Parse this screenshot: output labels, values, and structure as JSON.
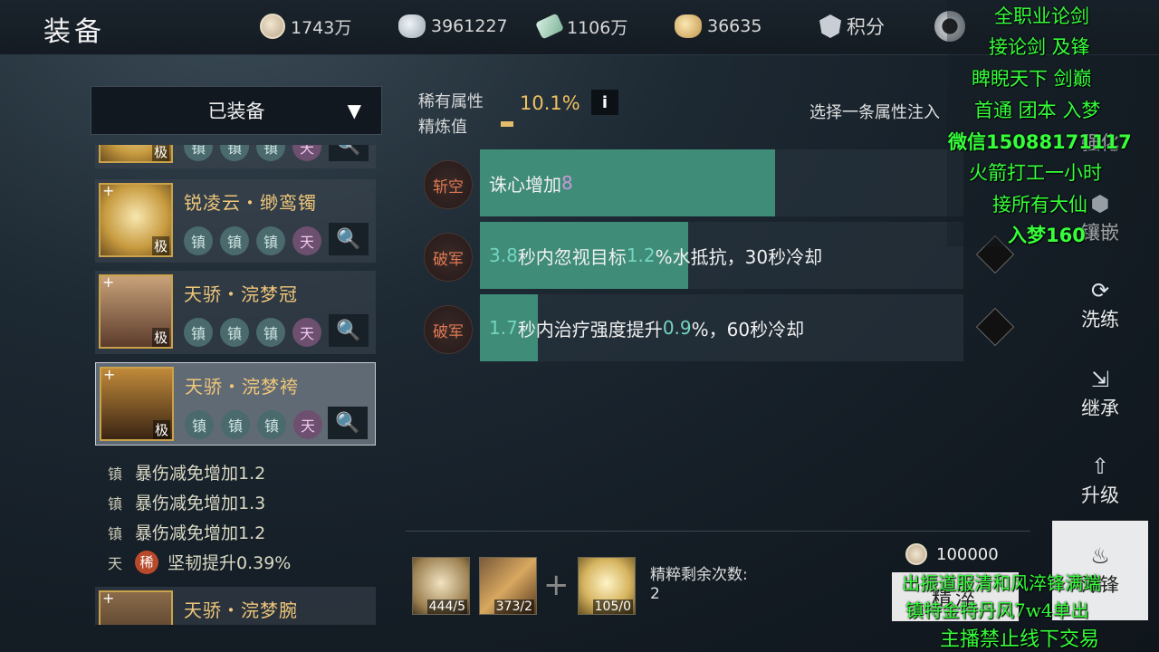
{
  "header": {
    "title": "装备",
    "resources": [
      {
        "icon": "coin-icon",
        "value": "1743万"
      },
      {
        "icon": "silver-ingot-icon",
        "value": "3961227"
      },
      {
        "icon": "jade-icon",
        "value": "1106万"
      },
      {
        "icon": "gold-ingot-icon",
        "value": "36635"
      }
    ],
    "points_label": "积分"
  },
  "left": {
    "dropdown_label": "已装备",
    "items": [
      {
        "name": "",
        "tier": "极",
        "tags": [
          "镇",
          "镇",
          "镇",
          "天"
        ]
      },
      {
        "name": "锐凌云・缈鸾镯",
        "tier": "极",
        "tags": [
          "镇",
          "镇",
          "镇",
          "天"
        ]
      },
      {
        "name": "天骄・浣梦冠",
        "tier": "极",
        "tags": [
          "镇",
          "镇",
          "镇",
          "天"
        ]
      },
      {
        "name": "天骄・浣梦袴",
        "tier": "极",
        "tags": [
          "镇",
          "镇",
          "镇",
          "天"
        ]
      },
      {
        "name": "天骄・浣梦腕",
        "tier": "",
        "tags": []
      }
    ],
    "stats": [
      {
        "kind": "镇",
        "text": "暴伤减免增加1.2"
      },
      {
        "kind": "镇",
        "text": "暴伤减免增加1.3"
      },
      {
        "kind": "镇",
        "text": "暴伤减免增加1.2"
      },
      {
        "kind": "天",
        "rare": "稀",
        "text": "坚韧提升0.39%"
      }
    ]
  },
  "center": {
    "rare_label": "稀有属性",
    "refine_label": "精炼值",
    "rare_pct": "10.1%",
    "info_label": "i",
    "choose_hint": "选择一条属性注入",
    "rows": [
      {
        "badge": "斩空",
        "fill": 0.61,
        "parts": [
          {
            "t": "诛心增加",
            "c": ""
          },
          {
            "t": "8",
            "c": "n2"
          }
        ]
      },
      {
        "badge": "破军",
        "fill": 0.43,
        "parts": [
          {
            "t": "3.8",
            "c": "n"
          },
          {
            "t": "秒内忽视目标",
            "c": ""
          },
          {
            "t": "1.2",
            "c": "n"
          },
          {
            "t": "%水抵抗，30秒冷却",
            "c": ""
          }
        ]
      },
      {
        "badge": "破军",
        "fill": 0.12,
        "parts": [
          {
            "t": "1.7",
            "c": "n"
          },
          {
            "t": "秒内治疗强度提升",
            "c": ""
          },
          {
            "t": "0.9",
            "c": "n"
          },
          {
            "t": "%，60秒冷却",
            "c": ""
          }
        ]
      }
    ]
  },
  "side": {
    "buttons": [
      "强化",
      "镶嵌",
      "洗练",
      "继承",
      "升级",
      "淬锋"
    ]
  },
  "bottom": {
    "materials": [
      {
        "count": "444/5"
      },
      {
        "count": "373/2"
      },
      {
        "count": "105/0"
      }
    ],
    "plus": "+",
    "remain_label": "精粹剩余次数:",
    "remain_value": "2",
    "cost": "100000",
    "refine_button": "精淬"
  },
  "overlay": {
    "lines": [
      "全职业论剑",
      "接论剑 及锋",
      "睥睨天下  剑巅",
      "首通 团本 入梦",
      "微信15088171117",
      "火箭打工一小时",
      "接所有大仙",
      "入梦160"
    ],
    "bottom_lines": [
      "出振道服清和风淬锋满端",
      "镇特金特丹风7w4单出",
      "主播禁止线下交易"
    ]
  }
}
